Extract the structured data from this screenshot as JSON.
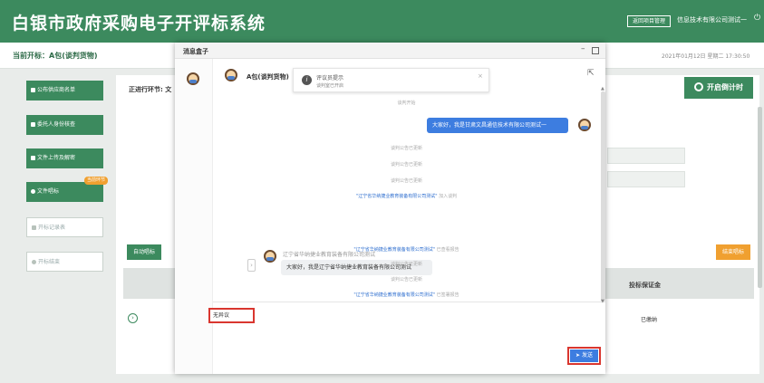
{
  "header": {
    "app_title": "白银市政府采购电子开评标系统",
    "return_btn": "返回项目管理",
    "company": "信息技术有限公司测试一"
  },
  "subbar": {
    "current_bid": "当前开标：A包(谈判货物)",
    "datetime": "2021年01月12日 星期二 17:30:50"
  },
  "sidebar": {
    "items": [
      {
        "label": "公布供应商名单",
        "state": "done"
      },
      {
        "label": "委托人身份核查",
        "state": "done"
      },
      {
        "label": "文件上传及解密",
        "state": "done"
      },
      {
        "label": "文件唱标",
        "state": "current",
        "badge": "当前环节"
      },
      {
        "label": "开标记录表",
        "state": "pending"
      },
      {
        "label": "开标结束",
        "state": "pending"
      }
    ]
  },
  "main": {
    "stage_label": "正进行环节: 文",
    "timer_button": "开启倒计时",
    "auto_button": "自动唱标",
    "end_button": "结束唱标",
    "col_deposit": "投标保证金",
    "row_status": "已缴纳"
  },
  "dialog": {
    "title": "消息盒子",
    "chat_name": "A包(谈判货物)",
    "toast": {
      "title": "评议员提示",
      "message": "谈判室已开启"
    },
    "messages": {
      "sys_top": "谈判开始",
      "mine": "大家好，我是甘肃文昌通信技术有限公司测试一",
      "sys_1": "谈判公告已更新",
      "sys_2": "谈判公告已更新",
      "sys_3": "谈判公告已更新",
      "join_company": "\"辽宁省华纳捷业教育装备有限公司测试\"",
      "join_action": "加入谈判",
      "sender": "辽宁省华纳捷业教育装备有限公司测试",
      "other": "大家好，我是辽宁省华纳捷业教育装备有限公司测试",
      "ack_company": "\"辽宁省华纳捷业教育装备有限公司测试\"",
      "ack_action": "已查看报告",
      "sys_4": "谈判公告已更新",
      "sys_5": "谈判公告已更新",
      "ack2_company": "\"辽宁省华纳捷业教育装备有限公司测试\"",
      "ack2_action": "已签署报告"
    },
    "input_value": "无异议",
    "send_button": "发送"
  },
  "colors": {
    "brand_green": "#3c8a5e",
    "accent_orange": "#f0a030",
    "chat_blue": "#3d7de0",
    "highlight_red": "#d9362f"
  }
}
